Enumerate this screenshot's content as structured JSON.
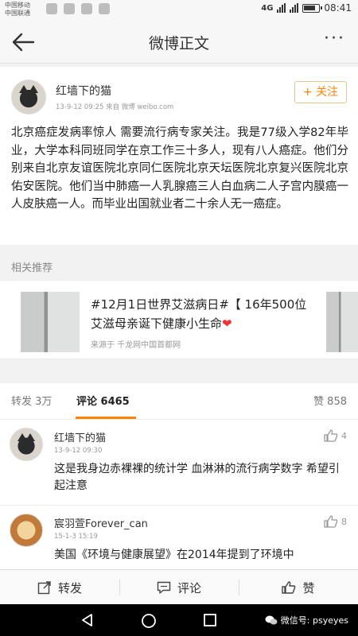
{
  "status_bar": {
    "carrier_1": "中国移动",
    "carrier_2": "中国联通",
    "network": "4G",
    "time": "08:41"
  },
  "nav": {
    "title": "微博正文",
    "more": "···",
    "back_icon": "arrow-left-icon"
  },
  "post": {
    "author": "红墙下的猫",
    "meta": "13-9-12 09:25  来自 微博 weibo.com",
    "follow_label": "+ 关注",
    "body": "北京癌症发病率惊人 需要流行病专家关注。我是77级入学82年毕业，大学本科同班同学在京工作三十多人，现有八人癌症。他们分别来自北京友谊医院北京同仁医院北京天坛医院北京复兴医院北京佑安医院。他们当中肺癌一人乳腺癌三人白血病二人子宫内膜癌一人皮肤癌一人。而毕业出国就业者二十余人无一癌症。"
  },
  "related": {
    "label": "相关推荐",
    "title": "#12月1日世界艾滋病日#【 16年500位艾滋母亲诞下健康小生命",
    "heart": "❤",
    "source": "来源于 千龙网中国首都网"
  },
  "tabs": {
    "repost": "转发 3万",
    "comments": "评论 6465",
    "likes": "赞 858"
  },
  "comments": [
    {
      "name": "红墙下的猫",
      "time": "13-9-12 09:30",
      "text": "这是我身边赤裸裸的统计学 血淋淋的流行病学数字 希望引起注意",
      "likes": "4"
    },
    {
      "name": "宸羽萱Forever_can",
      "time": "15-1-3 15:19",
      "text": "美国《环境与健康展望》在2014年提到了环境中",
      "likes": "8"
    }
  ],
  "action_bar": {
    "repost": "转发",
    "comment": "评论",
    "like": "赞"
  },
  "watermark": "微信号: psyeyes",
  "colors": {
    "accent": "#ff8200",
    "follow_border": "#e3c48e",
    "heart": "#ee3333"
  }
}
